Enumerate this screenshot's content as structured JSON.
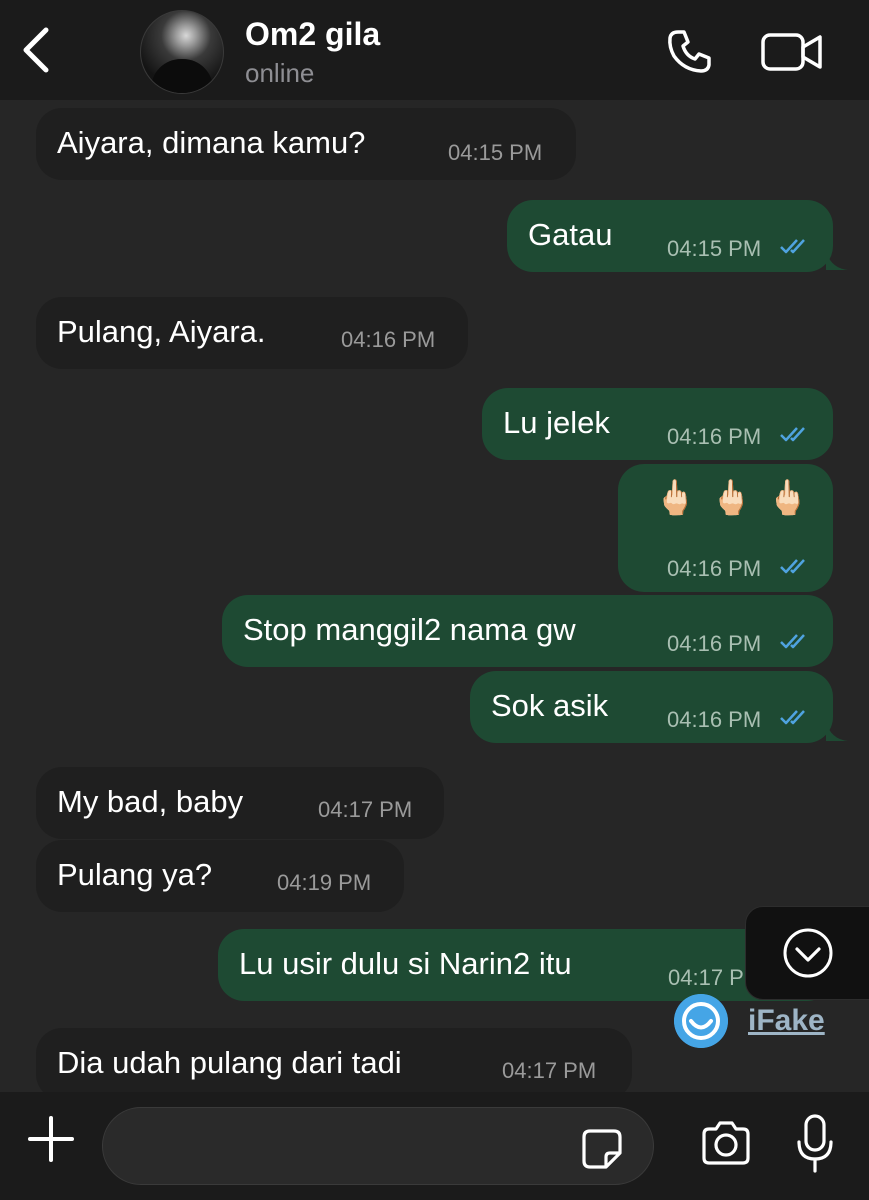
{
  "header": {
    "contact_name": "Om2 gila",
    "status": "online",
    "back_icon": "chevron-left-icon",
    "call_icon": "phone-icon",
    "video_icon": "video-camera-icon"
  },
  "messages": [
    {
      "direction": "incoming",
      "text": "Aiyara, dimana kamu?",
      "time": "04:15 PM"
    },
    {
      "direction": "outgoing",
      "text": "Gatau",
      "time": "04:15 PM",
      "read": true
    },
    {
      "direction": "incoming",
      "text": "Pulang, Aiyara.",
      "time": "04:16 PM"
    },
    {
      "direction": "outgoing",
      "text": "Lu jelek",
      "time": "04:16 PM",
      "read": true
    },
    {
      "direction": "outgoing",
      "text": "🖕🏻🖕🏻🖕🏻",
      "time": "04:16 PM",
      "read": true
    },
    {
      "direction": "outgoing",
      "text": "Stop manggil2 nama gw",
      "time": "04:16 PM",
      "read": true
    },
    {
      "direction": "outgoing",
      "text": "Sok asik",
      "time": "04:16 PM",
      "read": true
    },
    {
      "direction": "incoming",
      "text": "My bad, baby",
      "time": "04:17 PM"
    },
    {
      "direction": "incoming",
      "text": "Pulang ya?",
      "time": "04:19 PM"
    },
    {
      "direction": "outgoing",
      "text": "Lu usir dulu si Narin2 itu",
      "time": "04:17 PM",
      "read": true
    },
    {
      "direction": "incoming",
      "text": "Dia udah pulang dari tadi",
      "time": "04:17 PM"
    }
  ],
  "watermark": {
    "text": "iFake"
  },
  "input": {
    "placeholder": ""
  },
  "colors": {
    "background": "#262626",
    "incoming_bubble": "#1f1f1f",
    "outgoing_bubble": "#1e4a33",
    "read_tick": "#4fa3e0"
  }
}
